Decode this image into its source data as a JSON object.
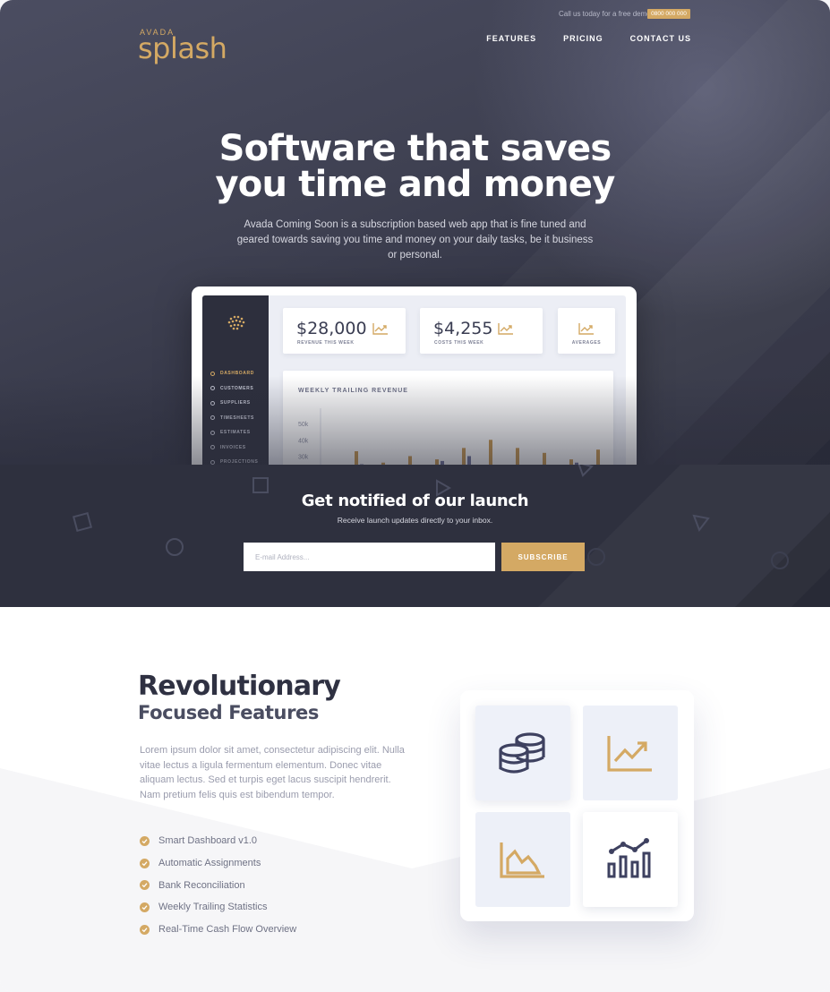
{
  "topbar": {
    "call_text": "Call us today for a free demo",
    "phone": "0800 000 000"
  },
  "brand": {
    "small": "AVADA",
    "name": "splash"
  },
  "nav": {
    "items": [
      "FEATURES",
      "PRICING",
      "CONTACT US"
    ]
  },
  "hero": {
    "title_line1": "Software that saves",
    "title_line2": "you time and money",
    "subtitle": "Avada Coming Soon is a subscription based web app that is fine tuned and geared towards saving you time and money on your daily tasks, be it business or personal."
  },
  "dashboard": {
    "menu": [
      "DASHBOARD",
      "CUSTOMERS",
      "SUPPLIERS",
      "TIMESHEETS",
      "ESTIMATES",
      "INVOICES",
      "PROJECTIONS"
    ],
    "active_menu": "DASHBOARD",
    "stats": [
      {
        "value": "$28,000",
        "label": "REVENUE THIS WEEK"
      },
      {
        "value": "$4,255",
        "label": "COSTS THIS WEEK"
      },
      {
        "value": "",
        "label": "AVERAGES"
      }
    ],
    "chart_title": "WEEKLY TRAILING REVENUE",
    "chart_data": {
      "type": "bar",
      "title": "WEEKLY TRAILING REVENUE",
      "y_ticks": [
        "50k",
        "40k",
        "30k"
      ],
      "ylim": [
        0,
        55
      ],
      "series": [
        {
          "values": [
            33,
            26,
            30,
            28,
            35,
            40,
            35,
            32,
            28,
            34
          ]
        },
        {
          "values": [
            25,
            20,
            18,
            27,
            30,
            22,
            24,
            21,
            26,
            24
          ]
        }
      ],
      "colors": [
        "#c8974c",
        "#6a6e96"
      ]
    }
  },
  "newsletter": {
    "title": "Get notified of our launch",
    "subtitle": "Receive launch updates directly to your inbox.",
    "email_placeholder": "E-mail Address...",
    "button": "SUBSCRIBE"
  },
  "features": {
    "title": "Revolutionary",
    "subtitle": "Focused Features",
    "body": "Lorem ipsum dolor sit amet, consectetur adipiscing elit. Nulla vitae lectus a ligula fermentum elementum. Donec vitae aliquam lectus. Sed et turpis eget lacus suscipit hendrerit. Nam pretium felis quis est bibendum tempor.",
    "list": [
      "Smart Dashboard v1.0",
      "Automatic Assignments",
      "Bank Reconciliation",
      "Weekly Trailing Statistics",
      "Real-Time Cash Flow Overview"
    ],
    "tiles": [
      "coins-icon",
      "trend-up-icon",
      "area-chart-icon",
      "bar-line-chart-icon"
    ]
  },
  "colors": {
    "accent": "#d4a964",
    "dark": "#2e303e",
    "navy": "#3e4160"
  }
}
